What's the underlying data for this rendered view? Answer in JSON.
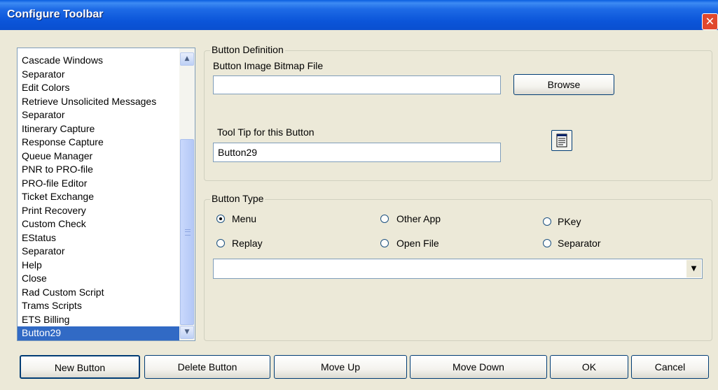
{
  "window": {
    "title": "Configure Toolbar",
    "close_glyph": "✕"
  },
  "button_list": {
    "items": [
      "Cascade Windows",
      "Separator",
      "Edit Colors",
      "Retrieve Unsolicited Messages",
      "Separator",
      "Itinerary Capture",
      "Response Capture",
      "Queue Manager",
      "PNR to PRO-file",
      "PRO-file Editor",
      "Ticket Exchange",
      "Print Recovery",
      "Custom Check",
      "EStatus",
      "Separator",
      "Help",
      "Close",
      "Rad Custom Script",
      "Trams Scripts",
      "ETS Billing",
      "Button29"
    ],
    "selected_index": 20,
    "scroll_up_glyph": "▲",
    "scroll_down_glyph": "▼"
  },
  "button_definition": {
    "legend": "Button Definition",
    "image_label": "Button Image Bitmap File",
    "image_value": "",
    "browse_label": "Browse",
    "tooltip_label": "Tool Tip for this Button",
    "tooltip_value": "Button29",
    "preview_icon": "document-list-icon"
  },
  "button_type": {
    "legend": "Button Type",
    "options": [
      "Menu",
      "Other App",
      "PKey",
      "Replay",
      "Open File",
      "Separator"
    ],
    "selected": "Menu",
    "combo_value": "",
    "combo_arrow_glyph": "▼"
  },
  "footer": {
    "new_button": "New Button",
    "delete_button": "Delete Button",
    "move_up": "Move Up",
    "move_down": "Move Down",
    "ok": "OK",
    "cancel": "Cancel"
  },
  "colors": {
    "titlebar": "#0a5ee0",
    "dialog_bg": "#ece9d8",
    "selection": "#316ac5",
    "close_button": "#e0482d"
  }
}
